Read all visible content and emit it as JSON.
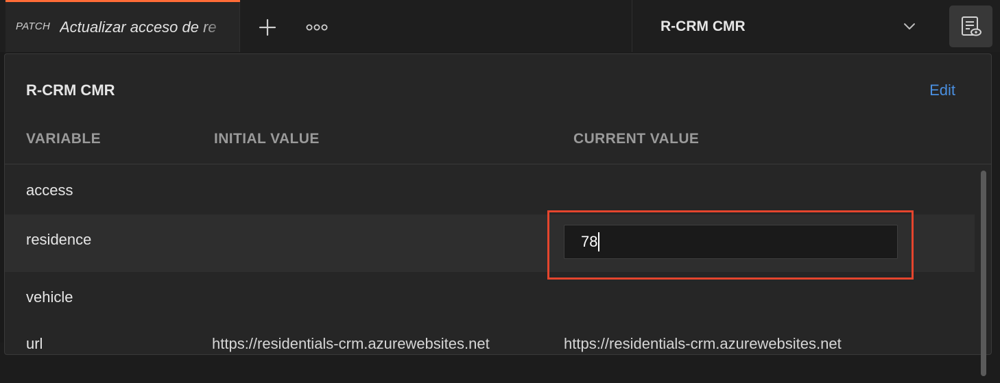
{
  "tab": {
    "method": "PATCH",
    "title": "Actualizar acceso de re"
  },
  "toolbar": {
    "new_tab_icon": "plus-icon",
    "more_icon": "more-horizontal-icon"
  },
  "environment": {
    "selected": "R-CRM CMR",
    "chevron_icon": "chevron-down-icon",
    "quicklook_icon": "environment-quick-look-icon"
  },
  "popover": {
    "title": "R-CRM CMR",
    "edit_label": "Edit",
    "columns": {
      "variable": "VARIABLE",
      "initial": "INITIAL VALUE",
      "current": "CURRENT VALUE"
    },
    "rows": [
      {
        "variable": "access",
        "initial": "",
        "current": ""
      },
      {
        "variable": "residence",
        "initial": "",
        "current": "78"
      },
      {
        "variable": "vehicle",
        "initial": "",
        "current": ""
      },
      {
        "variable": "url",
        "initial": "https://residentials-crm.azurewebsites.net",
        "current": "https://residentials-crm.azurewebsites.net"
      }
    ]
  },
  "colors": {
    "accent": "#ff6c37",
    "link": "#4a90e2",
    "highlight_border": "#e5452d"
  }
}
